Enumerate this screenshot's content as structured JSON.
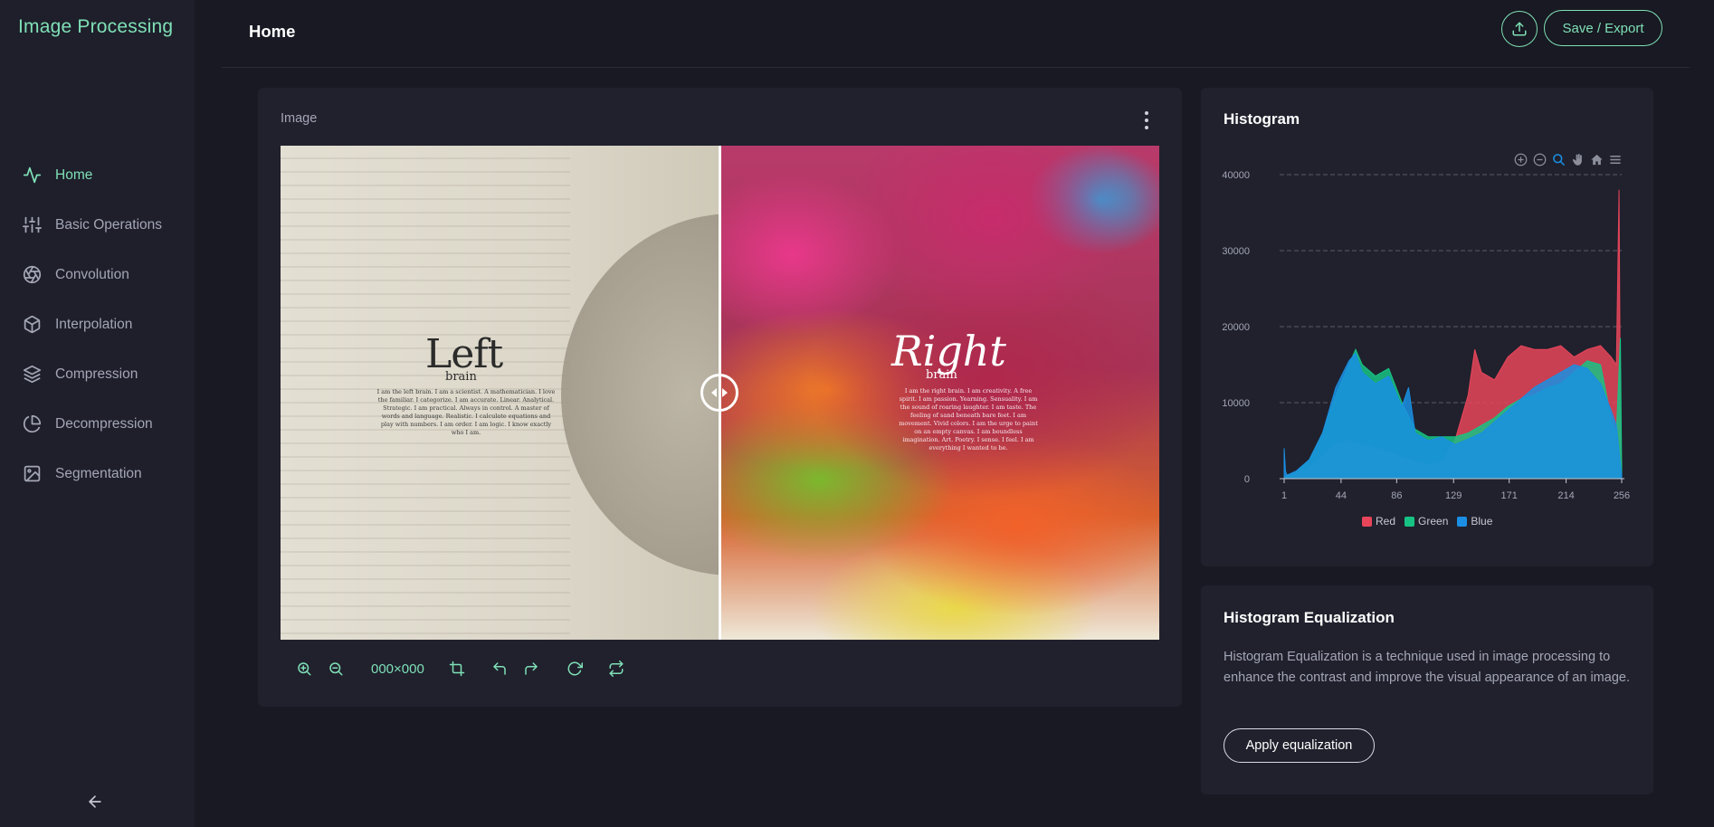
{
  "app": {
    "title": "Image Processing"
  },
  "sidebar": {
    "items": [
      {
        "label": "Home",
        "icon": "activity-icon",
        "active": true
      },
      {
        "label": "Basic Operations",
        "icon": "sliders-icon",
        "active": false
      },
      {
        "label": "Convolution",
        "icon": "aperture-icon",
        "active": false
      },
      {
        "label": "Interpolation",
        "icon": "box-icon",
        "active": false
      },
      {
        "label": "Compression",
        "icon": "layers-icon",
        "active": false
      },
      {
        "label": "Decompression",
        "icon": "pie-chart-icon",
        "active": false
      },
      {
        "label": "Segmentation",
        "icon": "image-icon",
        "active": false
      }
    ],
    "collapse_icon": "arrow-left-icon"
  },
  "header": {
    "title": "Home",
    "upload_icon": "upload-icon",
    "export_label": "Save / Export"
  },
  "image_card": {
    "label": "Image",
    "menu_icon": "more-vertical-icon",
    "image_text": {
      "left_title": "Left",
      "left_sub": "brain",
      "left_body": "I am the left brain. I am a scientist. A mathematician. I love the familiar. I categorize. I am accurate. Linear. Analytical. Strategic. I am practical. Always in control. A master of words and language. Realistic. I calculate equations and play with numbers. I am order. I am logic. I know exactly who I am.",
      "right_title": "Right",
      "right_sub": "brain",
      "right_body": "I am the right brain. I am creativity. A free spirit. I am passion. Yearning. Sensuality. I am the sound of roaring laughter. I am taste. The feeling of sand beneath bare feet. I am movement. Vivid colors. I am the urge to paint on an empty canvas. I am boundless imagination. Art. Poetry. I sense. I feel. I am everything I wanted to be."
    },
    "toolbar": {
      "dimensions": "000×000",
      "icons": [
        "zoom-in-icon",
        "zoom-out-icon",
        "crop-icon",
        "undo-icon",
        "redo-icon",
        "rotate-icon",
        "flip-icon"
      ]
    }
  },
  "histogram": {
    "title": "Histogram",
    "toolbar_icons": [
      "zoom-in-icon",
      "zoom-out-icon",
      "selection-zoom-icon",
      "pan-icon",
      "reset-home-icon",
      "menu-icon"
    ],
    "colors": {
      "red": "#e8455a",
      "green": "#17c384",
      "blue": "#1a8fe3",
      "grid": "#5a5b66",
      "axis_text": "#a4a6b6"
    }
  },
  "chart_data": {
    "type": "area",
    "title": "",
    "xlabel": "",
    "ylabel": "",
    "ylim": [
      0,
      40000
    ],
    "xlim": [
      1,
      256
    ],
    "yticks": [
      0,
      10000,
      20000,
      30000,
      40000
    ],
    "xticks": [
      1,
      44,
      86,
      129,
      171,
      214,
      256
    ],
    "grid": true,
    "legend_position": "bottom",
    "series": [
      {
        "name": "Red",
        "color": "#e8455a",
        "x": [
          1,
          10,
          20,
          30,
          40,
          50,
          60,
          70,
          80,
          90,
          100,
          110,
          120,
          130,
          140,
          145,
          150,
          160,
          170,
          180,
          190,
          200,
          210,
          220,
          230,
          240,
          248,
          252,
          254,
          255,
          256
        ],
        "y": [
          200,
          600,
          1500,
          3000,
          4500,
          5000,
          4500,
          4000,
          3500,
          2800,
          2200,
          1800,
          2200,
          5000,
          11000,
          17000,
          14000,
          13000,
          16000,
          17500,
          17000,
          17000,
          17500,
          16000,
          17000,
          17500,
          16000,
          15000,
          38000,
          9000,
          1000
        ]
      },
      {
        "name": "Green",
        "color": "#17c384",
        "x": [
          1,
          10,
          20,
          30,
          40,
          50,
          55,
          60,
          70,
          80,
          90,
          100,
          110,
          120,
          130,
          140,
          150,
          160,
          170,
          180,
          190,
          200,
          210,
          220,
          230,
          240,
          248,
          252,
          255,
          256
        ],
        "y": [
          300,
          800,
          2500,
          6000,
          11000,
          15000,
          17000,
          15000,
          13500,
          14500,
          10000,
          6500,
          5500,
          5500,
          5500,
          6000,
          7000,
          8000,
          9500,
          10500,
          11000,
          12000,
          12500,
          14000,
          15500,
          15000,
          8000,
          6000,
          18500,
          1000
        ]
      },
      {
        "name": "Blue",
        "color": "#1a8fe3",
        "x": [
          1,
          2,
          3,
          5,
          10,
          20,
          30,
          40,
          50,
          55,
          60,
          70,
          80,
          90,
          95,
          100,
          110,
          120,
          130,
          140,
          150,
          160,
          170,
          180,
          190,
          200,
          210,
          220,
          230,
          240,
          248,
          252,
          255,
          256
        ],
        "y": [
          4000,
          1000,
          500,
          600,
          1000,
          2500,
          6000,
          12000,
          15500,
          16500,
          14000,
          12500,
          13500,
          9500,
          12000,
          6000,
          5000,
          5500,
          4500,
          5200,
          6000,
          7500,
          9000,
          10500,
          12000,
          13000,
          14000,
          15000,
          14500,
          12500,
          9000,
          7000,
          2000,
          500
        ]
      }
    ]
  },
  "equalization": {
    "title": "Histogram Equalization",
    "description": "Histogram Equalization is a technique used in image processing to enhance the contrast and improve the visual appearance of an image.",
    "button_label": "Apply equalization"
  }
}
